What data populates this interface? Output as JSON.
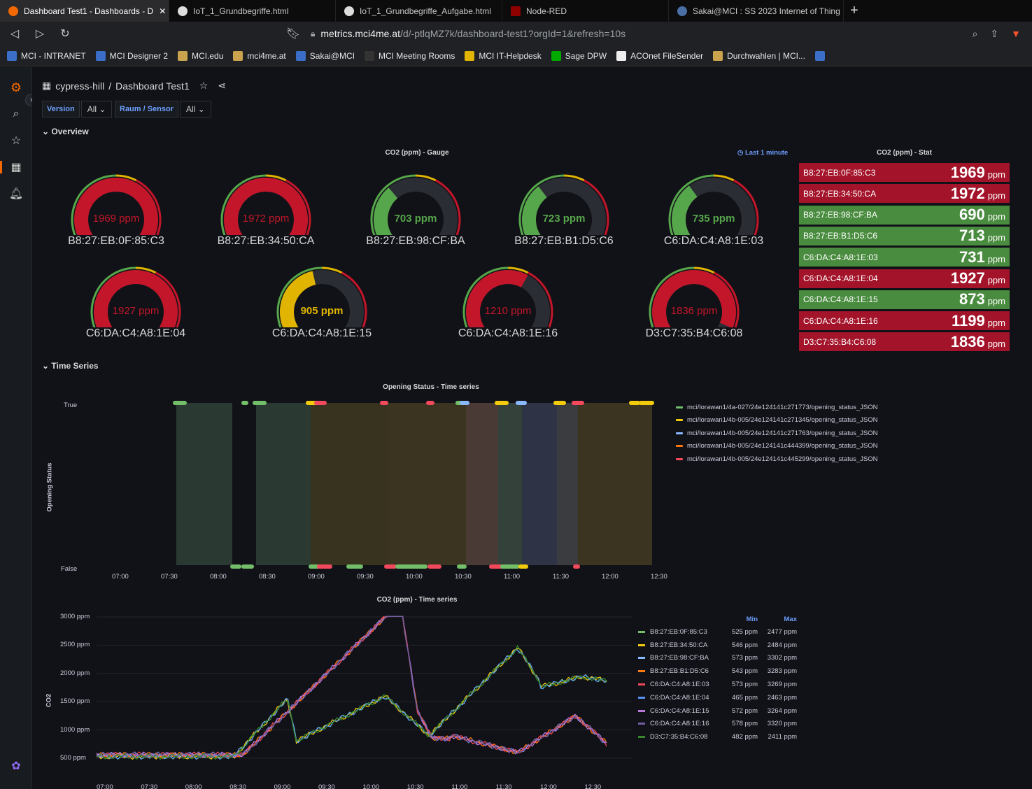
{
  "browser": {
    "tabs": [
      {
        "label": "Dashboard Test1 - Dashboards - D",
        "active": true
      },
      {
        "label": "IoT_1_Grundbegriffe.html",
        "active": false
      },
      {
        "label": "IoT_1_Grundbegriffe_Aufgabe.html",
        "active": false
      },
      {
        "label": "Node-RED",
        "active": false
      },
      {
        "label": "Sakai@MCI : SS 2023 Internet of Thing",
        "active": false
      }
    ],
    "url_host": "metrics.mci4me.at",
    "url_path": "/d/-ptlqMZ7k/dashboard-test1?orgId=1&refresh=10s",
    "bookmarks": [
      "MCI - INTRANET",
      "MCI Designer 2",
      "MCI.edu",
      "mci4me.at",
      "Sakai@MCI",
      "MCI Meeting Rooms",
      "MCI IT-Helpdesk",
      "Sage DPW",
      "ACOnet FileSender",
      "Durchwahlen | MCI..."
    ]
  },
  "dashboard": {
    "folder": "cypress-hill",
    "title": "Dashboard Test1",
    "variables": [
      {
        "label": "Version",
        "value": "All"
      },
      {
        "label": "Raum / Sensor",
        "value": "All"
      }
    ],
    "rows": {
      "overview": "Overview",
      "timeseries": "Time Series"
    }
  },
  "gauge_panel": {
    "title": "CO2 (ppm) - Gauge",
    "time_info": "Last 1 minute",
    "gauges": [
      {
        "name": "B8:27:EB:0F:85:C3",
        "value": 1969,
        "label": "1969 ppm",
        "status": "red"
      },
      {
        "name": "B8:27:EB:34:50:CA",
        "value": 1972,
        "label": "1972 ppm",
        "status": "red"
      },
      {
        "name": "B8:27:EB:98:CF:BA",
        "value": 703,
        "label": "703 ppm",
        "status": "green"
      },
      {
        "name": "B8:27:EB:B1:D5:C6",
        "value": 723,
        "label": "723 ppm",
        "status": "green"
      },
      {
        "name": "C6:DA:C4:A8:1E:03",
        "value": 735,
        "label": "735 ppm",
        "status": "green"
      },
      {
        "name": "C6:DA:C4:A8:1E:04",
        "value": 1927,
        "label": "1927 ppm",
        "status": "red"
      },
      {
        "name": "C6:DA:C4:A8:1E:15",
        "value": 905,
        "label": "905 ppm",
        "status": "yellow"
      },
      {
        "name": "C6:DA:C4:A8:1E:16",
        "value": 1210,
        "label": "1210 ppm",
        "status": "red"
      },
      {
        "name": "D3:C7:35:B4:C6:08",
        "value": 1836,
        "label": "1836 ppm",
        "status": "red"
      }
    ],
    "max": 2000
  },
  "stat_panel": {
    "title": "CO2 (ppm) - Stat",
    "unit": "ppm",
    "items": [
      {
        "name": "B8:27:EB:0F:85:C3",
        "value": "1969",
        "status": "red"
      },
      {
        "name": "B8:27:EB:34:50:CA",
        "value": "1972",
        "status": "red"
      },
      {
        "name": "B8:27:EB:98:CF:BA",
        "value": "690",
        "status": "green"
      },
      {
        "name": "B8:27:EB:B1:D5:C6",
        "value": "713",
        "status": "green"
      },
      {
        "name": "C6:DA:C4:A8:1E:03",
        "value": "731",
        "status": "green"
      },
      {
        "name": "C6:DA:C4:A8:1E:04",
        "value": "1927",
        "status": "red"
      },
      {
        "name": "C6:DA:C4:A8:1E:15",
        "value": "873",
        "status": "green"
      },
      {
        "name": "C6:DA:C4:A8:1E:16",
        "value": "1199",
        "status": "red"
      },
      {
        "name": "D3:C7:35:B4:C6:08",
        "value": "1836",
        "status": "red"
      }
    ]
  },
  "colors": {
    "red": "#c4162a",
    "green": "#56a64b",
    "yellow": "#e0b400",
    "stat_red": "#a3142a",
    "stat_green": "#4a8c3f"
  },
  "opening_panel": {
    "title": "Opening Status - Time series",
    "ylabel": "Opening Status",
    "yticks": [
      "True",
      "False"
    ],
    "xticks": [
      "07:00",
      "07:30",
      "08:00",
      "08:30",
      "09:00",
      "09:30",
      "10:00",
      "10:30",
      "11:00",
      "11:30",
      "12:00",
      "12:30"
    ],
    "legend": [
      {
        "name": "mci/lorawan1/4a-027/24e124141c271773/opening_status_JSON",
        "color": "#73bf69"
      },
      {
        "name": "mci/lorawan1/4b-005/24e124141c271345/opening_status_JSON",
        "color": "#f2cc0c"
      },
      {
        "name": "mci/lorawan1/4b-005/24e124141c271763/opening_status_JSON",
        "color": "#8ab8ff"
      },
      {
        "name": "mci/lorawan1/4b-005/24e124141c444399/opening_status_JSON",
        "color": "#ff780a"
      },
      {
        "name": "mci/lorawan1/4b-005/24e124141c445299/opening_status_JSON",
        "color": "#f2495c"
      }
    ]
  },
  "chart_data": {
    "type": "line",
    "title": "CO2 (ppm) - Time series",
    "ylabel": "CO2",
    "yticks": [
      "500 ppm",
      "1000 ppm",
      "1500 ppm",
      "2000 ppm",
      "2500 ppm",
      "3000 ppm"
    ],
    "ylim": [
      400,
      3000
    ],
    "xticks": [
      "07:00",
      "07:30",
      "08:00",
      "08:30",
      "09:00",
      "09:30",
      "10:00",
      "10:30",
      "11:00",
      "11:30",
      "12:00",
      "12:30"
    ],
    "legend_headers": {
      "min": "Min",
      "max": "Max"
    },
    "series": [
      {
        "name": "B8:27:EB:0F:85:C3",
        "color": "#73bf69",
        "min": "525 ppm",
        "max": "2477 ppm"
      },
      {
        "name": "B8:27:EB:34:50:CA",
        "color": "#f2cc0c",
        "min": "546 ppm",
        "max": "2484 ppm"
      },
      {
        "name": "B8:27:EB:98:CF:BA",
        "color": "#8ab8ff",
        "min": "573 ppm",
        "max": "3302 ppm"
      },
      {
        "name": "B8:27:EB:B1:D5:C6",
        "color": "#ff780a",
        "min": "543 ppm",
        "max": "3283 ppm"
      },
      {
        "name": "C6:DA:C4:A8:1E:03",
        "color": "#f2495c",
        "min": "573 ppm",
        "max": "3269 ppm"
      },
      {
        "name": "C6:DA:C4:A8:1E:04",
        "color": "#5794f2",
        "min": "465 ppm",
        "max": "2463 ppm"
      },
      {
        "name": "C6:DA:C4:A8:1E:15",
        "color": "#b877d9",
        "min": "572 ppm",
        "max": "3264 ppm"
      },
      {
        "name": "C6:DA:C4:A8:1E:16",
        "color": "#705da0",
        "min": "578 ppm",
        "max": "3320 ppm"
      },
      {
        "name": "D3:C7:35:B4:C6:08",
        "color": "#37872d",
        "min": "482 ppm",
        "max": "2411 ppm"
      }
    ]
  }
}
